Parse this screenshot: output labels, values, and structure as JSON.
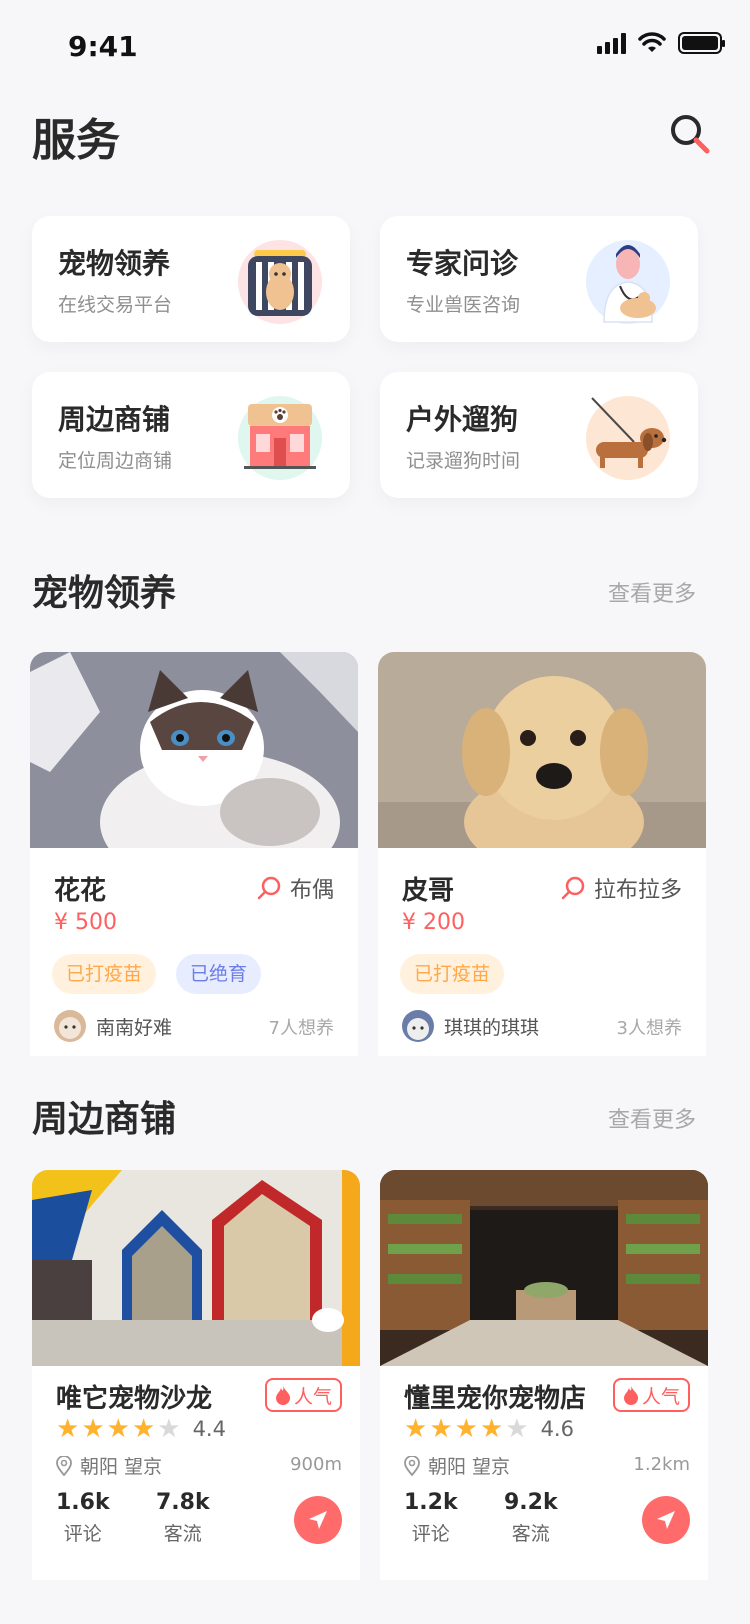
{
  "status_bar": {
    "time": "9:41"
  },
  "header": {
    "title": "服务"
  },
  "services": [
    {
      "title": "宠物领养",
      "subtitle": "在线交易平台",
      "icon": "pet-carrier-icon"
    },
    {
      "title": "专家问诊",
      "subtitle": "专业兽医咨询",
      "icon": "vet-doctor-icon"
    },
    {
      "title": "周边商铺",
      "subtitle": "定位周边商铺",
      "icon": "pet-shop-icon"
    },
    {
      "title": "户外遛狗",
      "subtitle": "记录遛狗时间",
      "icon": "dog-walking-icon"
    }
  ],
  "adoption": {
    "title": "宠物领养",
    "more": "查看更多",
    "pets": [
      {
        "name": "花花",
        "breed": "布偶",
        "price": "¥ 500",
        "tags": [
          "已打疫苗",
          "已绝育"
        ],
        "owner": "南南好难",
        "want": "7人想养"
      },
      {
        "name": "皮哥",
        "breed": "拉布拉多",
        "price": "¥ 200",
        "tags": [
          "已打疫苗"
        ],
        "owner": "琪琪的琪琪",
        "want": "3人想养"
      }
    ]
  },
  "stores": {
    "title": "周边商铺",
    "more": "查看更多",
    "items": [
      {
        "name": "唯它宠物沙龙",
        "badge": "人气",
        "rating": "4.4",
        "location": "朝阳 望京",
        "distance": "900m",
        "reviews": "1.6k",
        "reviews_label": "评论",
        "traffic": "7.8k",
        "traffic_label": "客流"
      },
      {
        "name": "懂里宠你宠物店",
        "badge": "人气",
        "rating": "4.6",
        "location": "朝阳 望京",
        "distance": "1.2km",
        "reviews": "1.2k",
        "reviews_label": "评论",
        "traffic": "9.2k",
        "traffic_label": "客流"
      }
    ]
  }
}
